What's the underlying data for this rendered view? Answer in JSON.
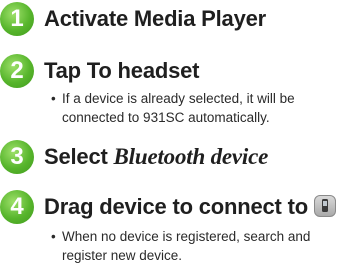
{
  "steps": [
    {
      "number": "1",
      "title": "Activate Media Player"
    },
    {
      "number": "2",
      "title": "Tap To headset",
      "note": "If a device is already selected, it will be connected to 931SC automatically."
    },
    {
      "number": "3",
      "title_prefix": "Select ",
      "title_emphasis": "Bluetooth device"
    },
    {
      "number": "4",
      "title": "Drag device to connect to",
      "icon": "phone-device-icon",
      "note": "When no device is registered, search and register new device."
    }
  ],
  "colors": {
    "badge": "#57b52c",
    "text": "#1f1f1f"
  }
}
